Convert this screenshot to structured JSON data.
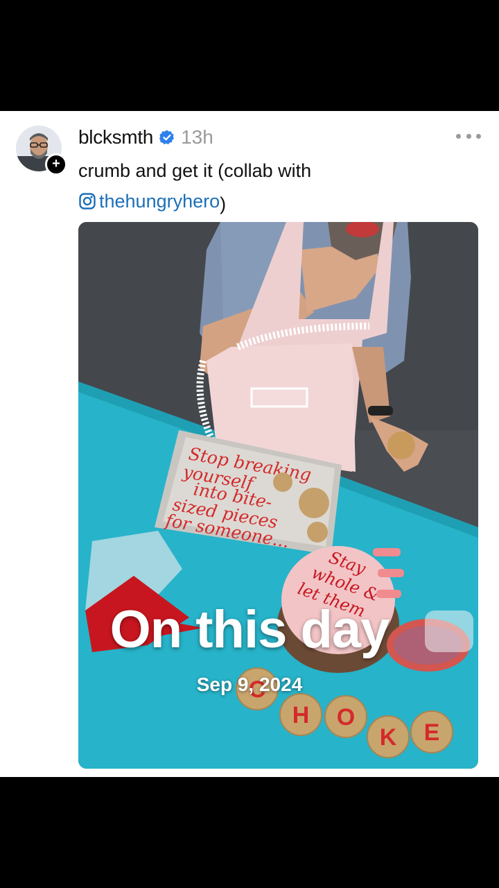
{
  "post": {
    "username": "blcksmth",
    "time": "13h",
    "caption_text": "crumb and get it (collab with",
    "mention": "thehungryhero",
    "mention_suffix": ")",
    "avatar_icon": "profile-photo",
    "verified_icon": "verified-badge-icon",
    "more_icon": "more-dots-icon",
    "follow_icon": "plus-icon"
  },
  "photo": {
    "tray_text": [
      "Stop breaking",
      "yourself",
      "into bite-",
      "sized pieces",
      "for someone..."
    ],
    "cake_text": [
      "Stay",
      "whole &",
      "let them"
    ],
    "cookie_letters": [
      "C",
      "H",
      "O",
      "K",
      "E"
    ]
  },
  "overlay": {
    "title": "On this day",
    "date": "Sep 9, 2024"
  },
  "colors": {
    "mention": "#1d6fb8",
    "verified": "#2f80ed",
    "table": "#27b3c9",
    "wall": "#4a4d52",
    "icing": "#d42a2a"
  }
}
